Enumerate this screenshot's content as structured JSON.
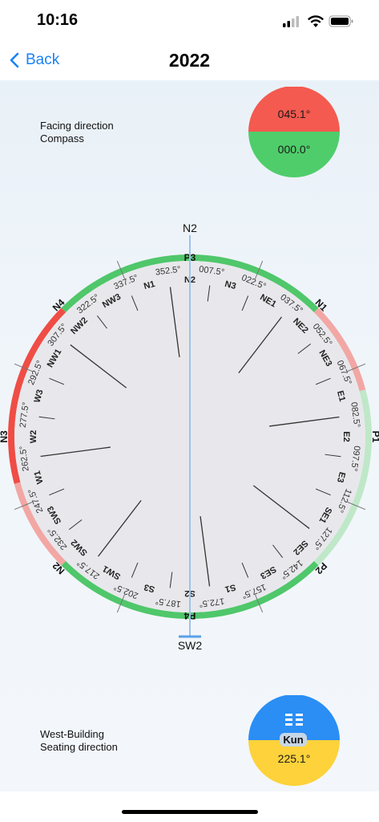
{
  "status_bar": {
    "time": "10:16",
    "icons": [
      "signal-icon",
      "wifi-icon",
      "battery-icon"
    ]
  },
  "nav": {
    "back_label": "Back",
    "title": "2022"
  },
  "facing": {
    "label_line1": "Facing direction",
    "label_line2": "Compass",
    "top_value": "045.1°",
    "bottom_value": "000.0°",
    "top_color": "#f45a4f",
    "bottom_color": "#4fcd6b"
  },
  "seating": {
    "label_line1": "West-Building",
    "label_line2": "Seating direction",
    "trigram_icon": "kun-trigram-icon",
    "trigram_name": "Kun",
    "value": "225.1°",
    "top_color": "#2a8ef5",
    "bottom_color": "#fdd23b"
  },
  "compass": {
    "needle_top_label": "N2",
    "needle_bottom_label": "SW2",
    "outer_labels": [
      "N1",
      "P1",
      "P2",
      "P4",
      "N2",
      "N3",
      "N4",
      "P3"
    ],
    "mountains": [
      "N2",
      "N3",
      "NE1",
      "NE2",
      "NE3",
      "E1",
      "E2",
      "E3",
      "SE1",
      "SE2",
      "SE3",
      "S1",
      "S2",
      "S3",
      "SW1",
      "SW2",
      "SW3",
      "W1",
      "W2",
      "W3",
      "NW1",
      "NW2",
      "NW3",
      "N1"
    ],
    "degrees": [
      "007.5°",
      "022.5°",
      "037.5°",
      "052.5°",
      "067.5°",
      "082.5°",
      "097.5°",
      "112.5°",
      "127.5°",
      "142.5°",
      "157.5°",
      "172.5°",
      "187.5°",
      "202.5°",
      "217.5°",
      "232.5°",
      "247.5°",
      "262.5°",
      "277.5°",
      "292.5°",
      "307.5°",
      "322.5°",
      "337.5°",
      "352.5°"
    ],
    "ring_colors": {
      "green": "#4fc76a",
      "red": "#ef4d45",
      "light_red": "#f2a7a4",
      "light_green": "#bfe8c8"
    }
  }
}
